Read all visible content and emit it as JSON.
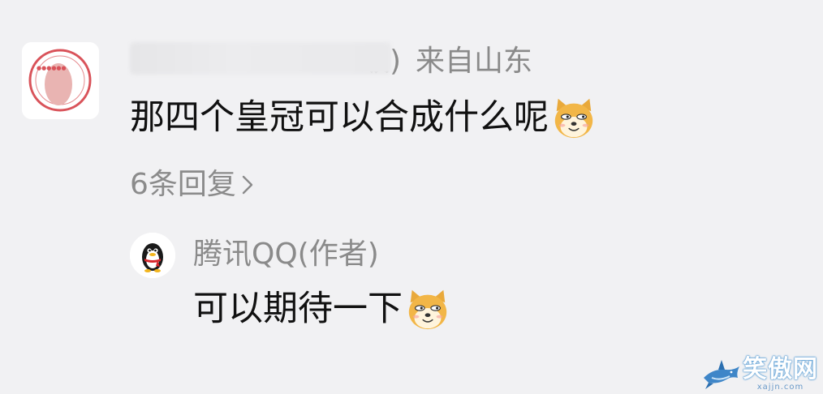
{
  "comment": {
    "user_suffix": "级)",
    "location": "来自山东",
    "text": "那四个皇冠可以合成什么呢",
    "emoji_icon": "doge-emoji",
    "replies_label": "6条回复"
  },
  "reply": {
    "username": "腾讯QQ(作者)",
    "text": "可以期待一下",
    "emoji_icon": "doge-emoji",
    "avatar_icon": "qq-penguin-icon"
  },
  "watermark": {
    "title": "笑傲网",
    "url": "xajjn.com"
  },
  "colors": {
    "background": "#f1f1f3",
    "text_primary": "#111111",
    "text_secondary": "#8a8a8a",
    "watermark_blue": "#5aa0d8"
  }
}
